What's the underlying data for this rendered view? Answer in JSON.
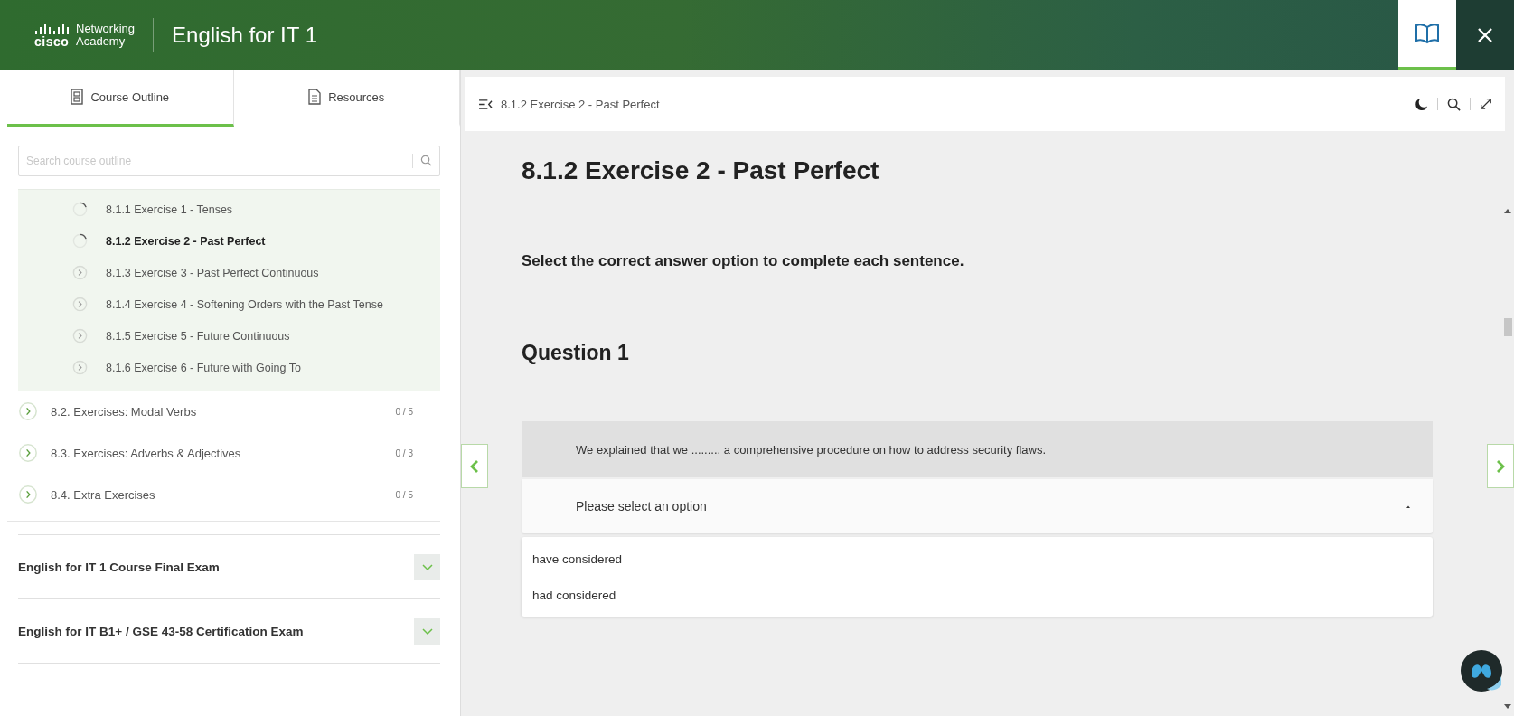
{
  "header": {
    "logo": {
      "brand": "cisco",
      "line_1": "Networking",
      "line_2": "Academy"
    },
    "title": "English for IT 1",
    "buttons": [
      {
        "kind": "book",
        "selected": true
      },
      {
        "kind": "close",
        "selected": false
      }
    ]
  },
  "sidebar": {
    "tabs": [
      {
        "label": "Course Outline",
        "kind": "outline",
        "selected": true
      },
      {
        "label": "Resources",
        "kind": "document",
        "selected": false
      }
    ],
    "search": {
      "placeholder": "Search course outline"
    },
    "lessons": [
      {
        "label": "8.1.1 Exercise 1 - Tenses",
        "kind": "started",
        "selected": false
      },
      {
        "label": "8.1.2 Exercise 2 - Past Perfect",
        "kind": "started",
        "selected": true
      },
      {
        "label": "8.1.3 Exercise 3 - Past Perfect Continuous",
        "kind": "unstarted",
        "selected": false
      },
      {
        "label": "8.1.4 Exercise 4 - Softening Orders with the Past Tense",
        "kind": "unstarted",
        "selected": false
      },
      {
        "label": "8.1.5 Exercise 5 - Future Continuous",
        "kind": "unstarted",
        "selected": false
      },
      {
        "label": "8.1.6 Exercise 6 - Future with Going To",
        "kind": "unstarted",
        "selected": false
      }
    ],
    "sections": [
      {
        "label": "8.2. Exercises: Modal Verbs",
        "count": "0 / 5"
      },
      {
        "label": "8.3. Exercises: Adverbs & Adjectives",
        "count": "0 / 3"
      },
      {
        "label": "8.4. Extra Exercises",
        "count": "0 / 5"
      }
    ],
    "exams": [
      {
        "label": "English for IT 1 Course Final Exam",
        "expanded": false
      },
      {
        "label": "English for IT B1+ / GSE 43-58 Certification Exam",
        "expanded": false
      }
    ]
  },
  "content": {
    "breadcrumb": "8.1.2 Exercise 2 - Past Perfect",
    "tools": [
      {
        "kind": "dark_mode"
      },
      {
        "kind": "search"
      },
      {
        "kind": "expand"
      }
    ],
    "title": "8.1.2 Exercise 2 - Past Perfect",
    "instruction": "Select the correct answer option to complete each sentence.",
    "question": {
      "heading": "Question 1",
      "sentence": "We explained that we ......... a comprehensive procedure on how to address security flaws.",
      "select": {
        "placeholder": "Please select an option",
        "expanded": true
      },
      "options": [
        {
          "label": "have considered",
          "selected": false
        },
        {
          "label": "had considered",
          "selected": false
        }
      ]
    }
  }
}
